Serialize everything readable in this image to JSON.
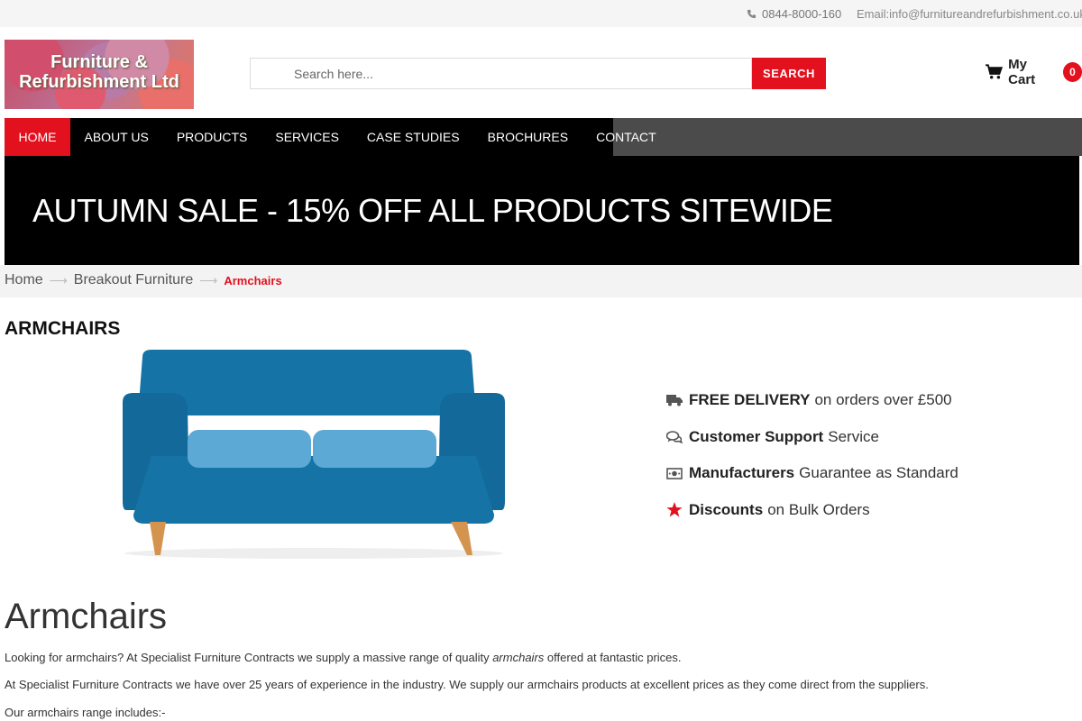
{
  "topbar": {
    "phone": "0844-8000-160",
    "email": "Email:info@furnitureandrefurbishment.co.uk"
  },
  "logo": {
    "line1": "Furniture &",
    "line2": "Refurbishment Ltd"
  },
  "search": {
    "placeholder": "Search here...",
    "button_label": "SEARCH"
  },
  "cart": {
    "label": "My Cart",
    "count": "0",
    "icon": "cart-icon"
  },
  "nav": {
    "items": [
      {
        "label": "HOME",
        "active": true
      },
      {
        "label": "ABOUT US"
      },
      {
        "label": "PRODUCTS"
      },
      {
        "label": "SERVICES"
      },
      {
        "label": "CASE STUDIES"
      },
      {
        "label": "BROCHURES"
      },
      {
        "label": "CONTACT"
      }
    ]
  },
  "banner": {
    "text": "AUTUMN SALE - 15% OFF ALL PRODUCTS SITEWIDE"
  },
  "breadcrumb": {
    "items": [
      "Home",
      "Breakout Furniture",
      "Armchairs"
    ]
  },
  "product": {
    "heading": "ARMCHAIRS"
  },
  "features": [
    {
      "icon": "truck-icon",
      "bold": "FREE DELIVERY",
      "text": "on orders over £500"
    },
    {
      "icon": "chat-icon",
      "bold": "Customer Support",
      "text": "Service"
    },
    {
      "icon": "money-icon",
      "bold": "Manufacturers",
      "text": "Guarantee as Standard"
    },
    {
      "icon": "star-icon",
      "bold": "Discounts",
      "text": "on Bulk Orders"
    }
  ],
  "content": {
    "title": "Armchairs",
    "p1_before": "Looking for armchairs? At Specialist Furniture Contracts we supply a massive range of quality ",
    "p1_em": "armchairs",
    "p1_after": " offered at fantastic prices.",
    "p2": "At Specialist Furniture Contracts we have over 25 years of experience in the industry. We supply our armchairs products at excellent prices as they come direct from the suppliers.",
    "p3": "Our armchairs range includes:-"
  },
  "colors": {
    "accent": "#e3101e",
    "nav_bg": "#000000",
    "nav_rest": "#4b4b4b",
    "sofa_body": "#1573a6",
    "sofa_cushion": "#5da9d6"
  }
}
